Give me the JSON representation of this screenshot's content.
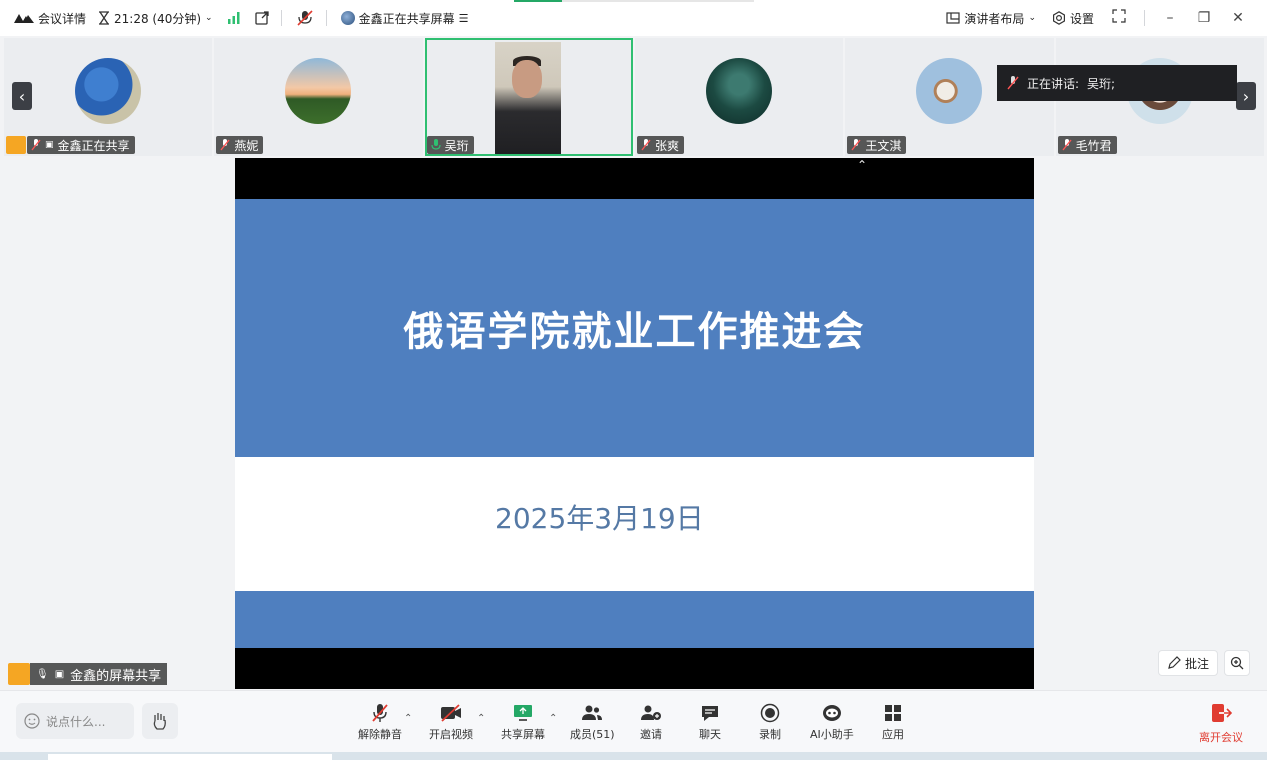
{
  "topbar": {
    "meeting_details": "会议详情",
    "timer": "21:28 (40分钟)",
    "sharing_status": "金鑫正在共享屏幕",
    "layout": "演讲者布局",
    "settings": "设置"
  },
  "participants": [
    {
      "name": "金鑫正在共享",
      "host": true
    },
    {
      "name": "燕妮"
    },
    {
      "name": "吴珩",
      "active": true
    },
    {
      "name": "张爽"
    },
    {
      "name": "王文淇"
    },
    {
      "name": "毛竹君"
    }
  ],
  "speaking": {
    "label": "正在讲话:",
    "name": "吴珩;"
  },
  "slide": {
    "title": "俄语学院就业工作推进会",
    "date": "2025年3月19日"
  },
  "share_tag": "金鑫的屏幕共享",
  "tools": {
    "annotate": "批注"
  },
  "toolbar": {
    "chat_placeholder": "说点什么...",
    "buttons": [
      {
        "label": "解除静音"
      },
      {
        "label": "开启视频"
      },
      {
        "label": "共享屏幕"
      },
      {
        "label": "成员(51)"
      },
      {
        "label": "邀请"
      },
      {
        "label": "聊天"
      },
      {
        "label": "录制"
      },
      {
        "label": "AI小助手"
      },
      {
        "label": "应用"
      }
    ],
    "leave": "离开会议"
  },
  "colors": {
    "accent_green": "#2fbf71",
    "slide_blue": "#4f7fbf",
    "leave_red": "#e03c31",
    "host_orange": "#f5a623"
  }
}
